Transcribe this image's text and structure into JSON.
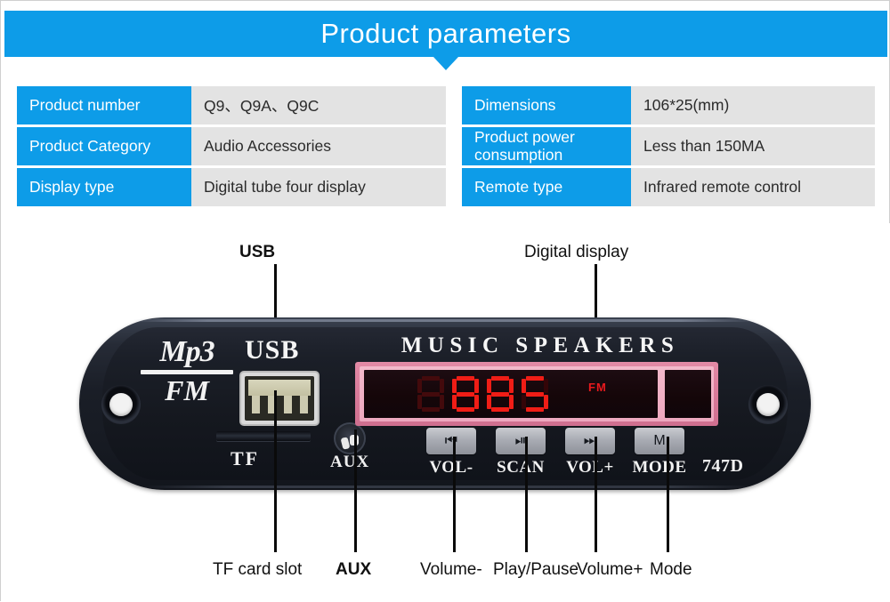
{
  "header": {
    "title": "Product parameters"
  },
  "spec_table": {
    "rows": [
      {
        "key_left": "Product number",
        "val_left": "Q9、Q9A、Q9C",
        "key_right": "Dimensions",
        "val_right": "106*25(mm)"
      },
      {
        "key_left": "Product Category",
        "val_left": "Audio Accessories",
        "key_right": "Product power consumption",
        "val_right": "Less than 150MA"
      },
      {
        "key_left": "Display type",
        "val_left": "Digital tube four display",
        "key_right": "Remote type",
        "val_right": "Infrared remote control"
      }
    ]
  },
  "board": {
    "logo_top": "Mp3",
    "logo_bottom": "FM",
    "usb_silk": "USB",
    "tf_silk": "TF",
    "aux_silk": "AUX",
    "brand_text": "MUSIC SPEAKERS",
    "model_number": "747D",
    "display": {
      "value": "885",
      "indicator": "FM"
    },
    "buttons": [
      {
        "glyph": "⏮",
        "label": "VOL-"
      },
      {
        "glyph": "⏯",
        "label": "SCAN"
      },
      {
        "glyph": "⏭",
        "label": "VOL+"
      },
      {
        "glyph": "M",
        "label": "MODE"
      }
    ]
  },
  "annotations": {
    "top": [
      {
        "label": "USB"
      },
      {
        "label": "Digital display"
      }
    ],
    "bottom": [
      {
        "label": "TF card slot"
      },
      {
        "label": "AUX"
      },
      {
        "label": "Volume-"
      },
      {
        "label": "Play/Pause"
      },
      {
        "label": "Volume+"
      },
      {
        "label": "Mode"
      }
    ]
  },
  "colors": {
    "accent_blue": "#0d9ce8",
    "cell_gray": "#e3e3e3",
    "led_red": "#f01d16",
    "bezel_pink": "#e38aa6"
  }
}
